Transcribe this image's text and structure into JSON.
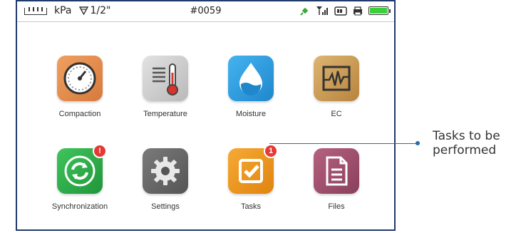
{
  "status_bar": {
    "unit": "kPa",
    "probe": "1/2\"",
    "device_id": "#0059",
    "battery_level": 1.0
  },
  "apps": [
    {
      "label": "Compaction",
      "icon": "gauge-icon",
      "color": "#e28a4a"
    },
    {
      "label": "Temperature",
      "icon": "thermometer-icon",
      "color": "#cfcfcf"
    },
    {
      "label": "Moisture",
      "icon": "water-drop-icon",
      "color": "#2f9fe0"
    },
    {
      "label": "EC",
      "icon": "ec-wave-icon",
      "color": "#c99852"
    },
    {
      "label": "Synchronization",
      "icon": "sync-icon",
      "color": "#2fb24a",
      "badge": "!"
    },
    {
      "label": "Settings",
      "icon": "gear-icon",
      "color": "#6b6b6b"
    },
    {
      "label": "Tasks",
      "icon": "checkbox-icon",
      "color": "#f19a1f",
      "badge": "1"
    },
    {
      "label": "Files",
      "icon": "document-icon",
      "color": "#a0506c"
    }
  ],
  "callout": {
    "line1": "Tasks to be",
    "line2": "performed"
  }
}
